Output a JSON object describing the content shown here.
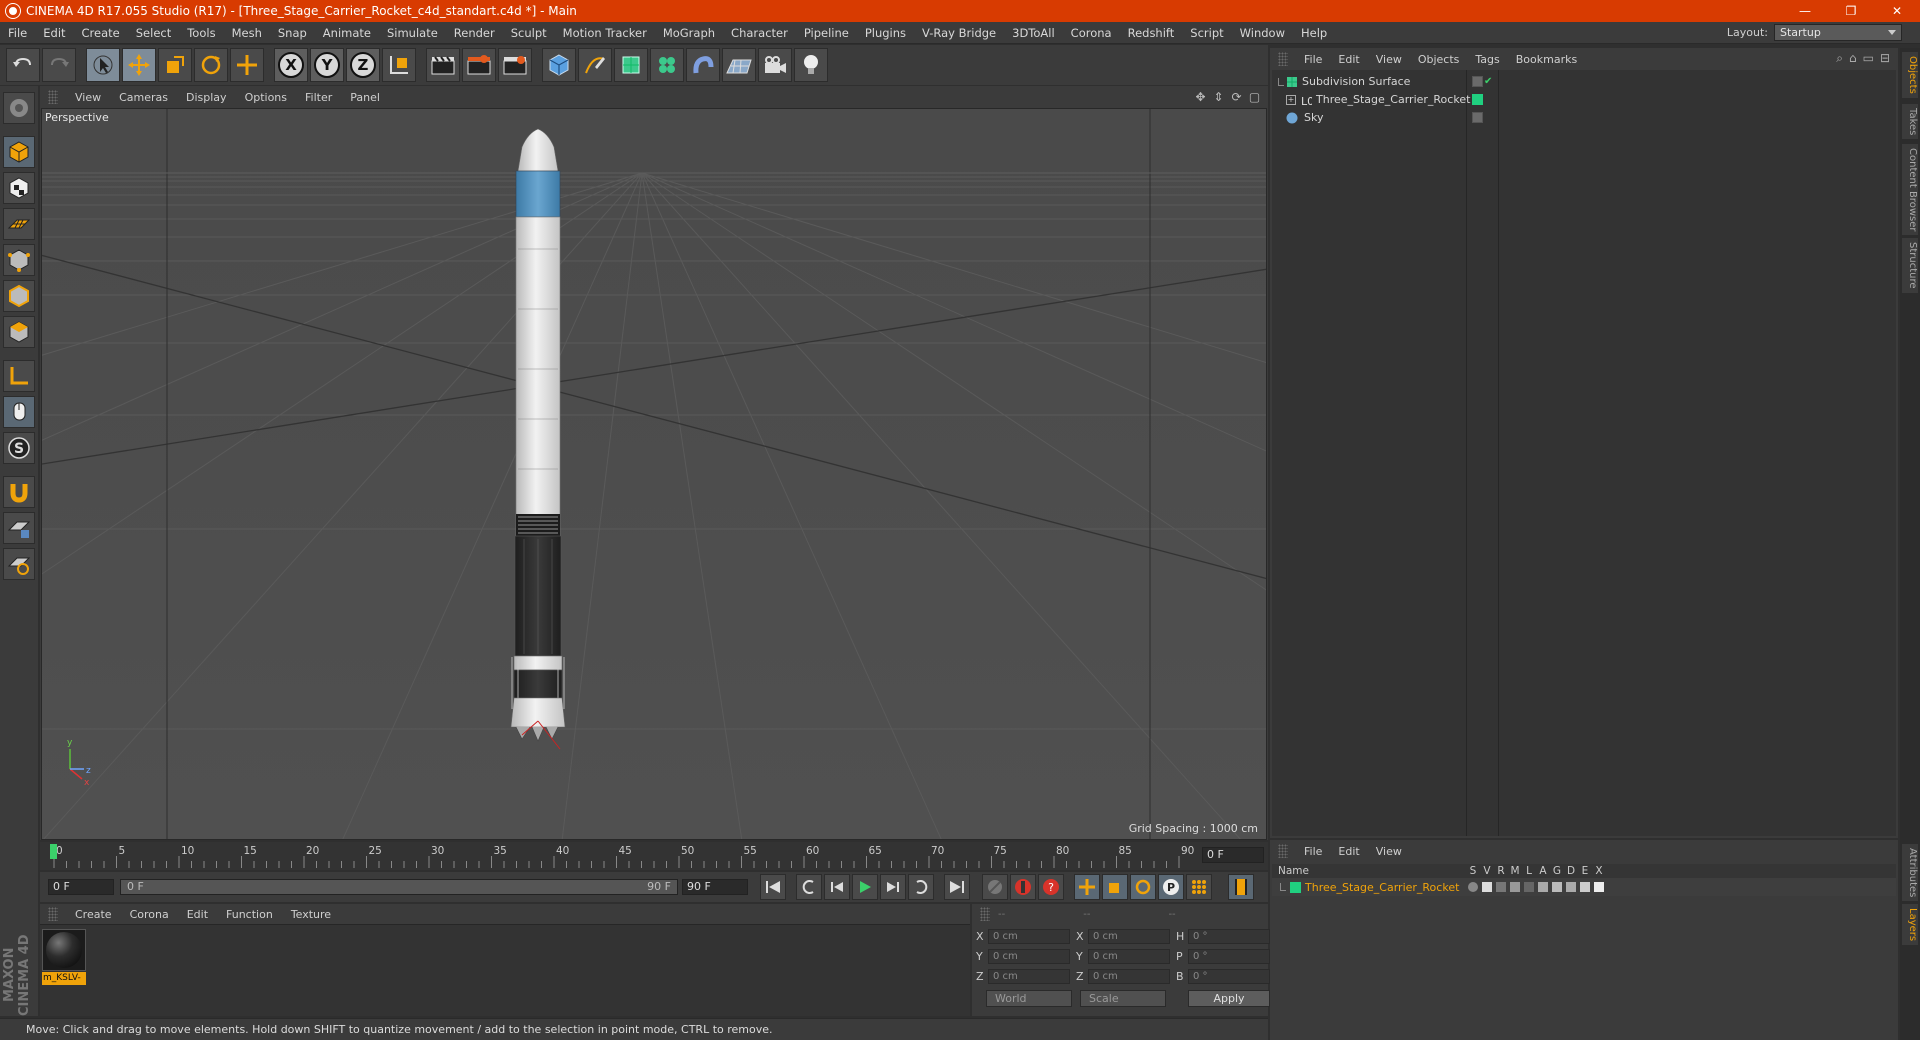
{
  "window": {
    "title": "CINEMA 4D R17.055 Studio (R17) - [Three_Stage_Carrier_Rocket_c4d_standart.c4d *] - Main",
    "controls": [
      "—",
      "❐",
      "✕"
    ]
  },
  "menubar": {
    "items": [
      "File",
      "Edit",
      "Create",
      "Select",
      "Tools",
      "Mesh",
      "Snap",
      "Animate",
      "Simulate",
      "Render",
      "Sculpt",
      "Motion Tracker",
      "MoGraph",
      "Character",
      "Pipeline",
      "Plugins",
      "V-Ray Bridge",
      "3DToAll",
      "Corona",
      "Redshift",
      "Script",
      "Window",
      "Help"
    ],
    "layout_label": "Layout:",
    "layout_value": "Startup"
  },
  "toolbar": {
    "axis_labels": [
      "X",
      "Y",
      "Z"
    ]
  },
  "viewport": {
    "menu": [
      "View",
      "Cameras",
      "Display",
      "Options",
      "Filter",
      "Panel"
    ],
    "camera_label": "Perspective",
    "grid_spacing": "Grid Spacing : 1000 cm"
  },
  "timeline": {
    "ticks": [
      "0",
      "5",
      "10",
      "15",
      "20",
      "25",
      "30",
      "35",
      "40",
      "45",
      "50",
      "55",
      "60",
      "65",
      "70",
      "75",
      "80",
      "85",
      "90"
    ],
    "current_frame": "0 F"
  },
  "transport": {
    "start_frame": "0 F",
    "range_start": "0 F",
    "range_end": "90 F",
    "end_frame": "90 F"
  },
  "material_manager": {
    "menu": [
      "Create",
      "Corona",
      "Edit",
      "Function",
      "Texture"
    ],
    "materials": [
      {
        "name": "m_KSLV-"
      }
    ]
  },
  "coordinates": {
    "headers": [
      "--",
      "--",
      "--"
    ],
    "rows": [
      {
        "pos_label": "X",
        "pos": "0 cm",
        "size_label": "X",
        "size": "0 cm",
        "rot_label": "H",
        "rot": "0 °"
      },
      {
        "pos_label": "Y",
        "pos": "0 cm",
        "size_label": "Y",
        "size": "0 cm",
        "rot_label": "P",
        "rot": "0 °"
      },
      {
        "pos_label": "Z",
        "pos": "0 cm",
        "size_label": "Z",
        "size": "0 cm",
        "rot_label": "B",
        "rot": "0 °"
      }
    ],
    "space_dropdown": "World",
    "mode_dropdown": "Scale",
    "apply_label": "Apply"
  },
  "status": {
    "text": "Move: Click and drag to move elements. Hold down SHIFT to quantize movement / add to the selection in point mode, CTRL to remove."
  },
  "object_manager": {
    "menu": [
      "File",
      "Edit",
      "View",
      "Objects",
      "Tags",
      "Bookmarks"
    ],
    "objects": [
      {
        "name": "Subdivision Surface"
      },
      {
        "name": "Three_Stage_Carrier_Rocket"
      },
      {
        "name": "Sky"
      }
    ]
  },
  "layer_manager": {
    "menu": [
      "File",
      "Edit",
      "View"
    ],
    "columns": [
      "Name",
      "S",
      "V",
      "R",
      "M",
      "L",
      "A",
      "G",
      "D",
      "E",
      "X"
    ],
    "layers": [
      {
        "name": "Three_Stage_Carrier_Rocket"
      }
    ]
  },
  "side_tabs": [
    "Objects",
    "Takes",
    "Content Browser",
    "Structure",
    "Attributes",
    "Layers"
  ],
  "branding": {
    "logo_text": "MAXON CINEMA 4D"
  },
  "colors": {
    "accent": "#f0a30a",
    "title_bar": "#d83b01",
    "layer_color": "#20d080"
  }
}
